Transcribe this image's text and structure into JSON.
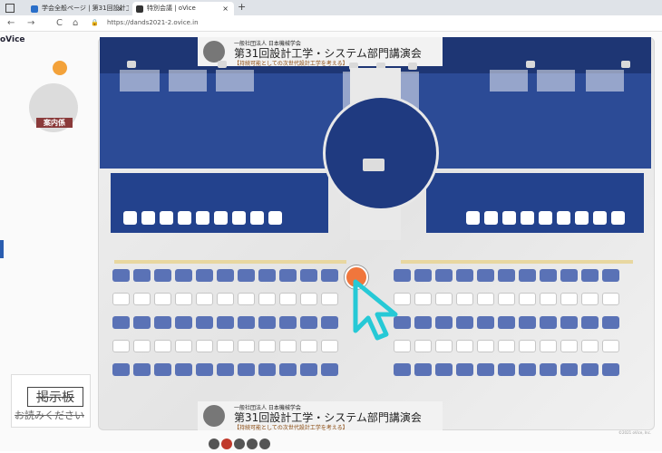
{
  "browser": {
    "tabs": [
      {
        "label": "学会全般ページ | 第31回設計工学・",
        "favicon_color": "#2a6fc9"
      },
      {
        "label": "特別会議 | oVice",
        "favicon_color": "#333333"
      }
    ],
    "new_tab": "+",
    "tab_close": "×",
    "nav": {
      "back": "←",
      "forward": "→",
      "reload": "C",
      "home": "⌂",
      "lock": "🔒"
    },
    "url": "https://dands2021-2.ovice.in"
  },
  "app": {
    "logo": "oVice",
    "guide_label": "案内係",
    "poster_top": {
      "org": "一般社団法人 日本機械学会",
      "title": "第31回設計工学・システム部門講演会",
      "subtitle": "【持続可能としての次世代設計工学を考える】"
    },
    "poster_bottom": {
      "org": "一般社団法人 日本機械学会",
      "title": "第31回設計工学・システム部門講演会",
      "subtitle": "【持続可能としての次世代設計工学を考える】"
    },
    "bulletin": {
      "title": "掲示板",
      "subtitle": "お読みください"
    },
    "copyright": "©2021 oVice, Inc."
  },
  "colors": {
    "stage_blue": "#2c4b96",
    "seat_blue": "#5a72b6",
    "cursor": "#26c9d6"
  }
}
